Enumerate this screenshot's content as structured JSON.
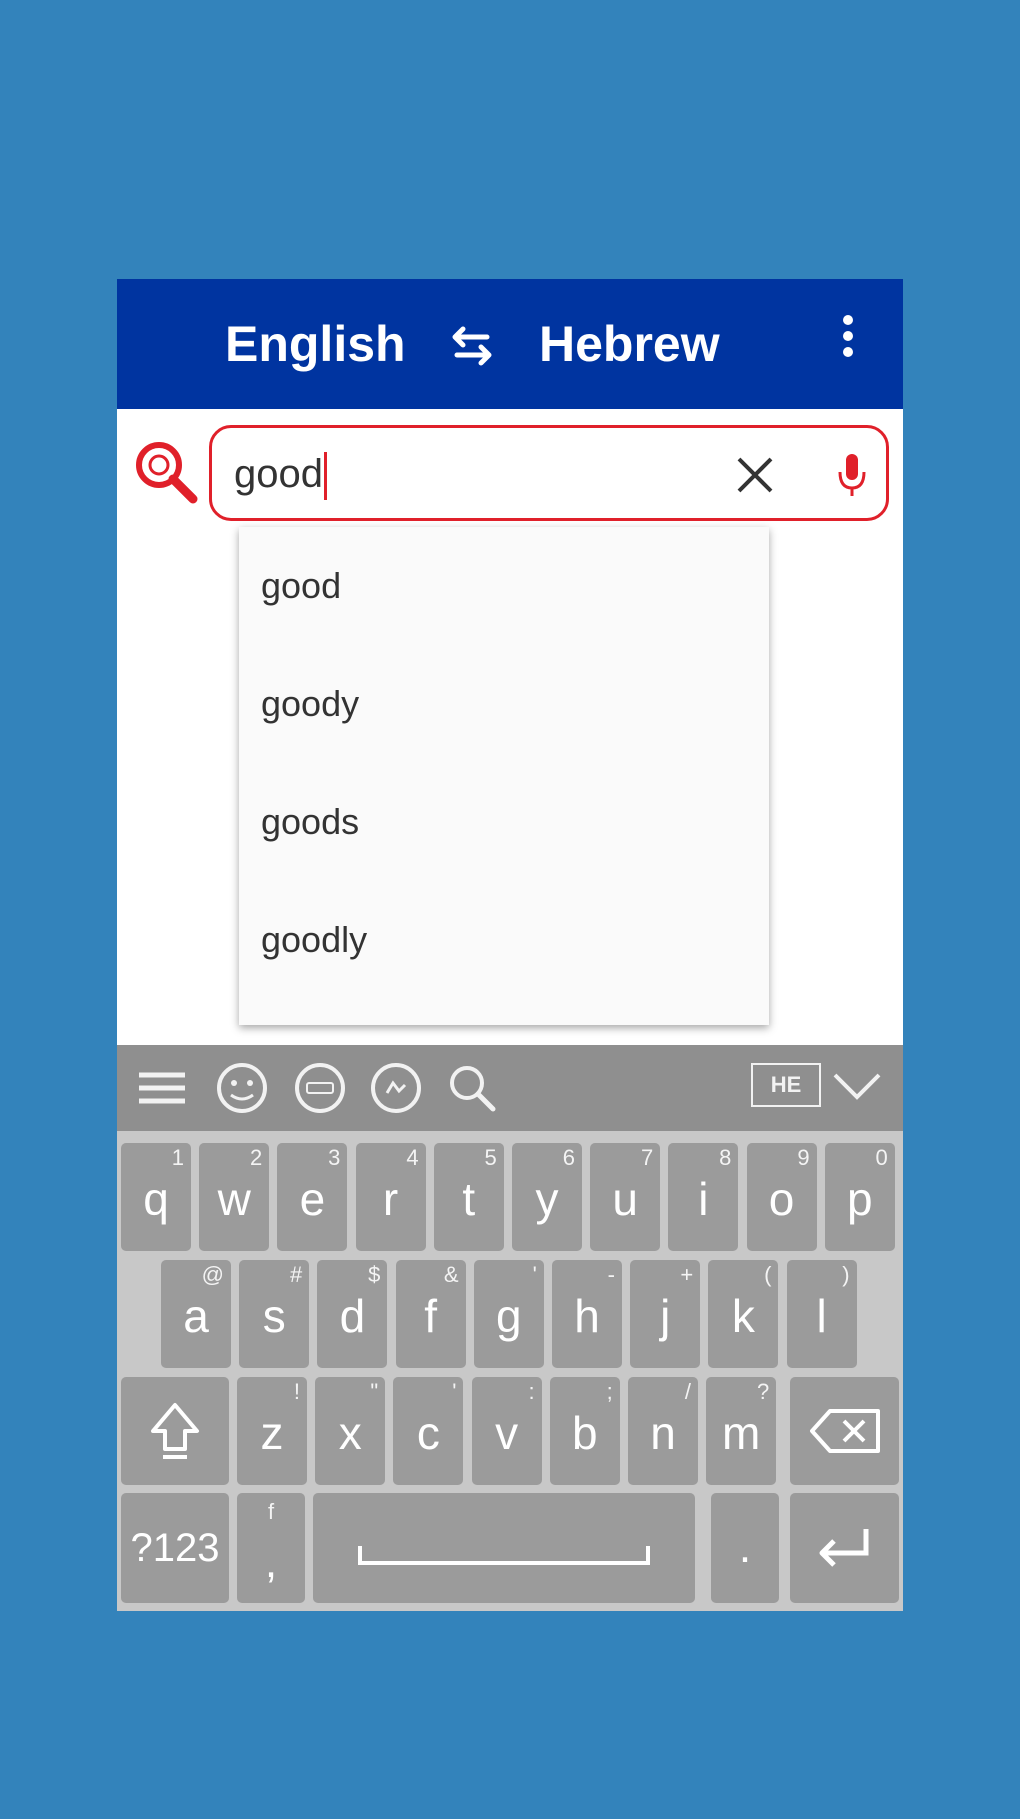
{
  "header": {
    "source_language": "English",
    "target_language": "Hebrew"
  },
  "search": {
    "query": "good"
  },
  "suggestions": [
    "good",
    "goody",
    "goods",
    "goodly"
  ],
  "keyboard": {
    "toolbar_language_badge": "HE",
    "row1": [
      {
        "key": "q",
        "hint": "1"
      },
      {
        "key": "w",
        "hint": "2"
      },
      {
        "key": "e",
        "hint": "3"
      },
      {
        "key": "r",
        "hint": "4"
      },
      {
        "key": "t",
        "hint": "5"
      },
      {
        "key": "y",
        "hint": "6"
      },
      {
        "key": "u",
        "hint": "7"
      },
      {
        "key": "i",
        "hint": "8"
      },
      {
        "key": "o",
        "hint": "9"
      },
      {
        "key": "p",
        "hint": "0"
      }
    ],
    "row2": [
      {
        "key": "a",
        "hint": "@"
      },
      {
        "key": "s",
        "hint": "#"
      },
      {
        "key": "d",
        "hint": "$"
      },
      {
        "key": "f",
        "hint": "&"
      },
      {
        "key": "g",
        "hint": "'"
      },
      {
        "key": "h",
        "hint": "-"
      },
      {
        "key": "j",
        "hint": "+"
      },
      {
        "key": "k",
        "hint": "("
      },
      {
        "key": "l",
        "hint": ")"
      }
    ],
    "row3": [
      {
        "key": "z",
        "hint": "!"
      },
      {
        "key": "x",
        "hint": "\""
      },
      {
        "key": "c",
        "hint": "'"
      },
      {
        "key": "v",
        "hint": ":"
      },
      {
        "key": "b",
        "hint": ";"
      },
      {
        "key": "n",
        "hint": "/"
      },
      {
        "key": "m",
        "hint": "?"
      }
    ],
    "symbols_key": "?123",
    "comma_key": ",",
    "emoji_alt_hint": "f",
    "period_key": "."
  },
  "colors": {
    "background": "#3383bb",
    "appbar": "#0034a0",
    "accent_red": "#e0202a",
    "key": "#9b9b9b",
    "keyboard_bg": "#c8c8c8",
    "toolbar": "#8f8f8f"
  }
}
